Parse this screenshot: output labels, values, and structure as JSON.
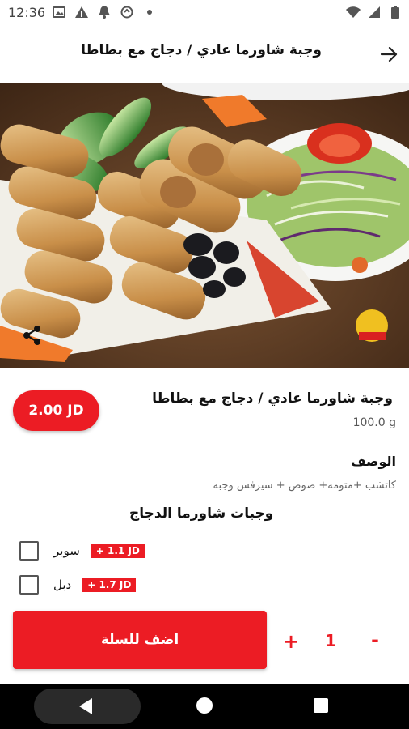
{
  "status_bar": {
    "time": "12:36",
    "icons_left": [
      "gallery-icon",
      "warning-icon",
      "notification-bell-icon",
      "sync-icon",
      "dot-icon"
    ],
    "icons_right": [
      "wifi-icon",
      "signal-icon",
      "battery-icon"
    ]
  },
  "app_bar": {
    "title": "وجبة شاورما عادي / دجاج مع بطاطا",
    "back_icon": "arrow-back-icon"
  },
  "product": {
    "image_description_icon": "shawarma-photo",
    "share_icon": "share-icon",
    "name": "وجبة شاورما عادي / دجاج مع بطاطا",
    "weight": "100.0 g",
    "price": "2.00 JD"
  },
  "description": {
    "label": "الوصف",
    "text": "كاتشب +متومه+ صوص + سيرفس وجبه"
  },
  "addons": {
    "title": "وجبات شاورما الدجاج",
    "options": [
      {
        "label": "سوبر",
        "price": "+ 1.1 JD",
        "checked": false
      },
      {
        "label": "دبل",
        "price": "+ 1.7 JD",
        "checked": false
      }
    ]
  },
  "cart": {
    "add_label": "اضف للسلة",
    "plus": "+",
    "quantity": "1",
    "minus": "-"
  },
  "colors": {
    "accent": "#ec1c24",
    "nav_bar": "#000000"
  }
}
